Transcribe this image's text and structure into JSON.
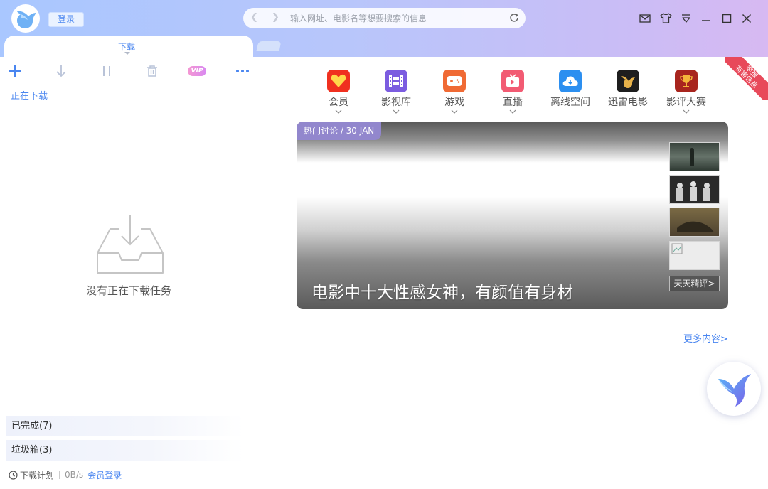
{
  "app": {
    "login_label": "登录"
  },
  "address_bar": {
    "placeholder": "输入网址、电影名等想要搜索的信息"
  },
  "tabs": {
    "active_label": "下载"
  },
  "toolbar": {
    "vip_label": "VIP",
    "icons": [
      "plus-icon",
      "download-arrow-icon",
      "pause-icon",
      "trash-icon",
      "vip-icon",
      "more-icon"
    ]
  },
  "download_panel": {
    "section_label": "正在下载",
    "empty_text": "没有正在下载任务",
    "completed_label": "已完成(7)",
    "trash_label": "垃圾箱(3)"
  },
  "status_bar": {
    "plan_label": "下载计划",
    "speed": "0B/s",
    "member_login": "会员登录"
  },
  "categories": [
    {
      "label": "会员",
      "icon": "member-heart-icon",
      "color": "#f0301f",
      "has_dropdown": true
    },
    {
      "label": "影视库",
      "icon": "film-icon",
      "color": "#7b5ce0",
      "has_dropdown": true
    },
    {
      "label": "游戏",
      "icon": "gamepad-icon",
      "color": "#f06a34",
      "has_dropdown": true
    },
    {
      "label": "直播",
      "icon": "tv-icon",
      "color": "#f25b73",
      "has_dropdown": true
    },
    {
      "label": "离线空间",
      "icon": "cloud-icon",
      "color": "#2c8ff0",
      "has_dropdown": false
    },
    {
      "label": "迅雷电影",
      "icon": "bird-icon",
      "color": "#1e1e1e",
      "has_dropdown": false
    },
    {
      "label": "影评大赛",
      "icon": "trophy-icon",
      "color": "#a8251e",
      "has_dropdown": true
    }
  ],
  "ribbon": {
    "line1": "举报",
    "line2": "有害信息"
  },
  "banner": {
    "tag": "热门讨论 / 30 JAN",
    "title": "电影中十大性感女神，有颜值有身材",
    "daily_label": "天天精评>"
  },
  "more_link": "更多内容>"
}
